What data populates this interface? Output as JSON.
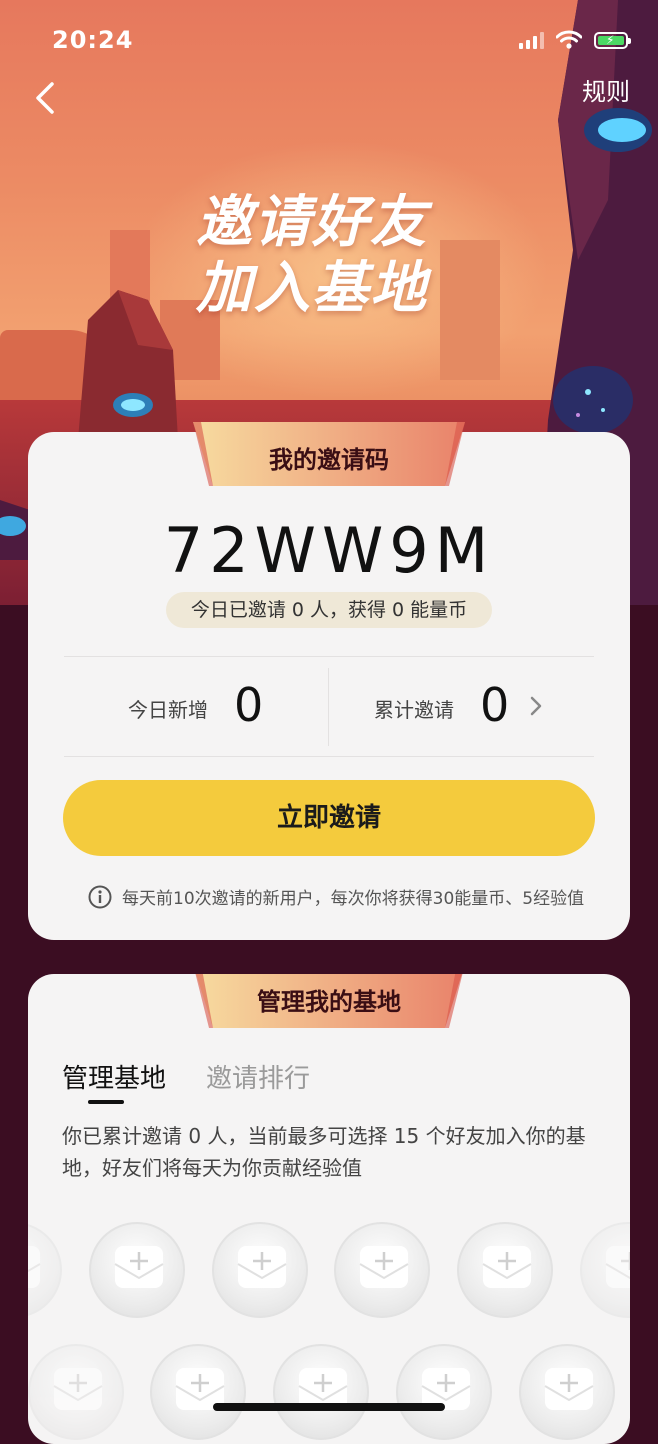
{
  "status_bar": {
    "time": "20:24"
  },
  "header": {
    "rules_label": "规则"
  },
  "hero": {
    "title_line1": "邀请好友",
    "title_line2": "加入基地"
  },
  "invite_card": {
    "ribbon_title": "我的邀请码",
    "invite_code": "72WW9M",
    "today_summary": "今日已邀请 0 人，获得 0 能量币",
    "today_new_label": "今日新增",
    "today_new_value": "0",
    "total_invited_label": "累计邀请",
    "total_invited_value": "0",
    "invite_button_label": "立即邀请",
    "tip_text": "每天前10次邀请的新用户，每次你将获得30能量币、5经验值"
  },
  "base_card": {
    "ribbon_title": "管理我的基地",
    "tabs": [
      {
        "label": "管理基地",
        "active": true
      },
      {
        "label": "邀请排行",
        "active": false
      }
    ],
    "description": "你已累计邀请 0 人，当前最多可选择 15 个好友加入你的基地，好友们将每天为你贡献经验值"
  },
  "colors": {
    "accent_yellow": "#f4cb3d",
    "background_dark": "#3b0d22",
    "card_bg": "#f5f4f4",
    "ribbon_start": "#f7dca0",
    "ribbon_end": "#e9826a"
  },
  "icons": [
    "back-arrow-icon",
    "wifi-icon",
    "signal-icon",
    "battery-charging-icon",
    "chevron-right-icon",
    "info-icon",
    "add-envelope-icon"
  ]
}
